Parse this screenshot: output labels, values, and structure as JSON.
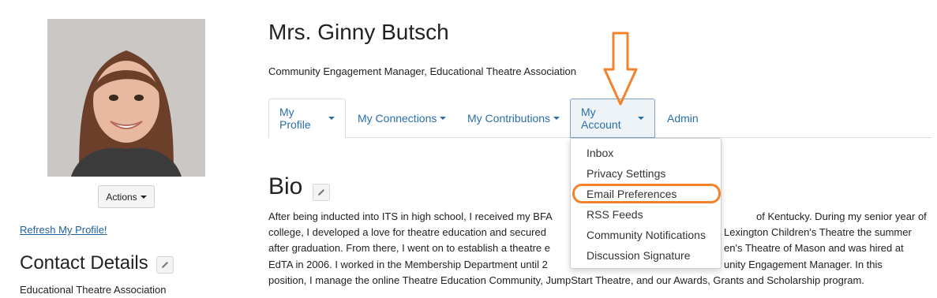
{
  "profile": {
    "actions_label": "Actions",
    "refresh_link": "Refresh My Profile!",
    "contact_title": "Contact Details",
    "organization": "Educational Theatre Association"
  },
  "header": {
    "name": "Mrs. Ginny Butsch",
    "job_title": "Community Engagement Manager, Educational Theatre Association"
  },
  "tabs": [
    {
      "label": "My Profile",
      "has_dropdown": true
    },
    {
      "label": "My Connections",
      "has_dropdown": true
    },
    {
      "label": "My Contributions",
      "has_dropdown": true
    },
    {
      "label": "My Account",
      "has_dropdown": true,
      "active": true
    },
    {
      "label": "Admin",
      "has_dropdown": false
    }
  ],
  "account_menu": {
    "items": [
      "Inbox",
      "Privacy Settings",
      "Email Preferences",
      "RSS Feeds",
      "Community Notifications",
      "Discussion Signature"
    ],
    "highlighted": "Email Preferences"
  },
  "bio": {
    "title": "Bio",
    "lines": [
      "After being inducted into ITS in high school, I received my BFA",
      "of Kentucky. During my senior year of",
      "college, I developed a love for theatre education and secured",
      "Lexington Children's Theatre the summer",
      "after graduation. From there, I went on to establish a theatre e",
      "en's Theatre of Mason and was hired at",
      "EdTA in 2006. I worked in the Membership Department until 2",
      "unity Engagement Manager. In this",
      "position, I manage the online Theatre Education Community, JumpStart Theatre, and our Awards, Grants and Scholarship program."
    ]
  },
  "colors": {
    "link": "#2a6ea8",
    "annotation": "#f2822b",
    "active_tab_border": "#7fa3c9"
  },
  "icons": [
    "pencil-icon",
    "caret-down-icon",
    "down-arrow-annotation"
  ]
}
